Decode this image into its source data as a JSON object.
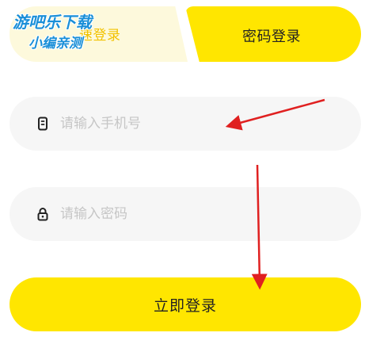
{
  "tabs": {
    "quick_login_label": "快捷登录",
    "quick_login_visible": "速登录",
    "password_login_label": "密码登录"
  },
  "watermark": {
    "line1": "游吧乐下载",
    "line2": "小编亲测"
  },
  "phone_field": {
    "placeholder": "请输入手机号",
    "icon": "phone-icon"
  },
  "password_field": {
    "placeholder": "请输入密码",
    "icon": "lock-icon"
  },
  "login_button": {
    "label": "立即登录"
  },
  "colors": {
    "accent": "#ffe600",
    "accent_text": "#f2c200",
    "arrow": "#e02020",
    "field_bg": "#f6f6f6"
  }
}
